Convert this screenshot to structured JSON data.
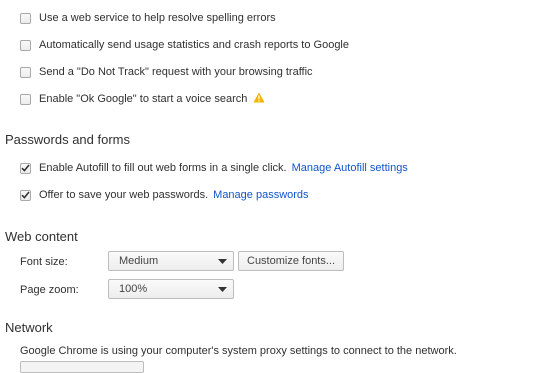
{
  "privacy": {
    "items": [
      {
        "label": "Use a web service to help resolve spelling errors",
        "checked": false
      },
      {
        "label": "Automatically send usage statistics and crash reports to Google",
        "checked": false
      },
      {
        "label": "Send a \"Do Not Track\" request with your browsing traffic",
        "checked": false
      },
      {
        "label": "Enable \"Ok Google\" to start a voice search",
        "checked": false,
        "icon": "warning-icon"
      }
    ]
  },
  "passwords": {
    "heading": "Passwords and forms",
    "autofill": {
      "label": "Enable Autofill to fill out web forms in a single click.",
      "link": "Manage Autofill settings",
      "checked": true
    },
    "save_passwords": {
      "label": "Offer to save your web passwords.",
      "link": "Manage passwords",
      "checked": true
    }
  },
  "web_content": {
    "heading": "Web content",
    "font_size_label": "Font size:",
    "font_size_value": "Medium",
    "customize_fonts_button": "Customize fonts...",
    "page_zoom_label": "Page zoom:",
    "page_zoom_value": "100%"
  },
  "network": {
    "heading": "Network",
    "description": "Google Chrome is using your computer's system proxy settings to connect to the network."
  },
  "colors": {
    "link": "#1155cc",
    "warning": "#f4b400"
  }
}
